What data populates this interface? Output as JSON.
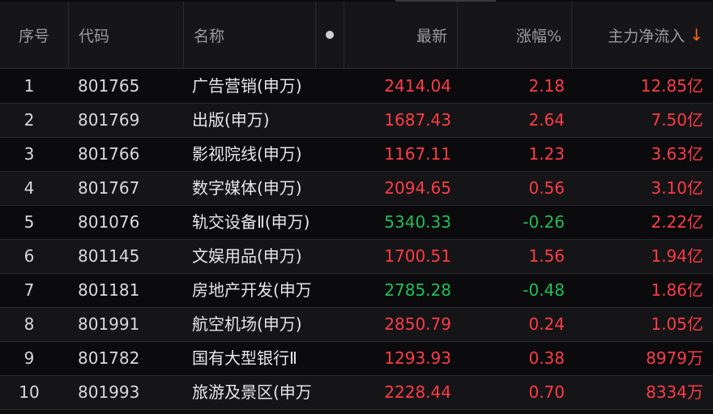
{
  "header": {
    "col_index": "序号",
    "col_code": "代码",
    "col_name": "名称",
    "col_last": "最新",
    "col_change": "涨幅%",
    "col_flow": "主力净流入",
    "sort_arrow": "↓"
  },
  "colors": {
    "up": "#ff3b46",
    "down": "#1fbf57",
    "sort": "#ff6a1a"
  },
  "rows": [
    {
      "idx": "1",
      "code": "801765",
      "name": "广告营销(申万)",
      "last": "2414.04",
      "change": "2.18",
      "flow": "12.85亿",
      "dir": "up"
    },
    {
      "idx": "2",
      "code": "801769",
      "name": "出版(申万)",
      "last": "1687.43",
      "change": "2.64",
      "flow": "7.50亿",
      "dir": "up"
    },
    {
      "idx": "3",
      "code": "801766",
      "name": "影视院线(申万)",
      "last": "1167.11",
      "change": "1.23",
      "flow": "3.63亿",
      "dir": "up"
    },
    {
      "idx": "4",
      "code": "801767",
      "name": "数字媒体(申万)",
      "last": "2094.65",
      "change": "0.56",
      "flow": "3.10亿",
      "dir": "up"
    },
    {
      "idx": "5",
      "code": "801076",
      "name": "轨交设备Ⅱ(申万)",
      "last": "5340.33",
      "change": "-0.26",
      "flow": "2.22亿",
      "dir": "down"
    },
    {
      "idx": "6",
      "code": "801145",
      "name": "文娱用品(申万)",
      "last": "1700.51",
      "change": "1.56",
      "flow": "1.94亿",
      "dir": "up"
    },
    {
      "idx": "7",
      "code": "801181",
      "name": "房地产开发(申万)",
      "last": "2785.28",
      "change": "-0.48",
      "flow": "1.86亿",
      "dir": "down"
    },
    {
      "idx": "8",
      "code": "801991",
      "name": "航空机场(申万)",
      "last": "2850.79",
      "change": "0.24",
      "flow": "1.05亿",
      "dir": "up"
    },
    {
      "idx": "9",
      "code": "801782",
      "name": "国有大型银行Ⅱ",
      "last": "1293.93",
      "change": "0.38",
      "flow": "8979万",
      "dir": "up"
    },
    {
      "idx": "10",
      "code": "801993",
      "name": "旅游及景区(申万)",
      "last": "2228.44",
      "change": "0.70",
      "flow": "8334万",
      "dir": "up"
    }
  ]
}
